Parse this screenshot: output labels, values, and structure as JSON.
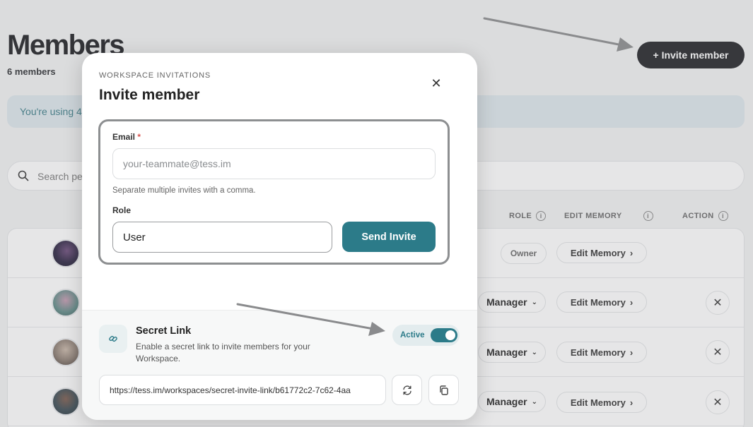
{
  "page": {
    "title": "Members",
    "member_count": "6 members",
    "invite_button": "+ Invite member",
    "usage_banner": "You're using 4",
    "search_placeholder": "Search pe",
    "columns": {
      "role": "ROLE",
      "edit_memory": "EDIT MEMORY",
      "action": "ACTION"
    },
    "rows": [
      {
        "role": "Owner",
        "edit_memory": "Edit Memory"
      },
      {
        "role": "Manager",
        "edit_memory": "Edit Memory"
      },
      {
        "role": "Manager",
        "edit_memory": "Edit Memory"
      },
      {
        "role": "Manager",
        "edit_memory": "Edit Memory"
      }
    ]
  },
  "modal": {
    "eyebrow": "WORKSPACE INVITATIONS",
    "title": "Invite member",
    "email_label": "Email",
    "email_required": "*",
    "email_placeholder": "your-teammate@tess.im",
    "email_hint": "Separate multiple invites with a comma.",
    "role_label": "Role",
    "role_value": "User",
    "send_button": "Send Invite",
    "secret_link": {
      "title": "Secret Link",
      "description": "Enable a secret link to invite members for your Workspace.",
      "toggle_label": "Active",
      "toggle_on": true,
      "url": "https://tess.im/workspaces/secret-invite-link/b61772c2-7c62-4aa"
    }
  },
  "colors": {
    "accent": "#2c7b89",
    "dark_button": "#1f2124"
  },
  "icons": [
    "close-icon",
    "search-icon",
    "info-icon",
    "chevron-down-icon",
    "chevron-right-icon",
    "link-icon",
    "refresh-icon",
    "copy-icon"
  ]
}
